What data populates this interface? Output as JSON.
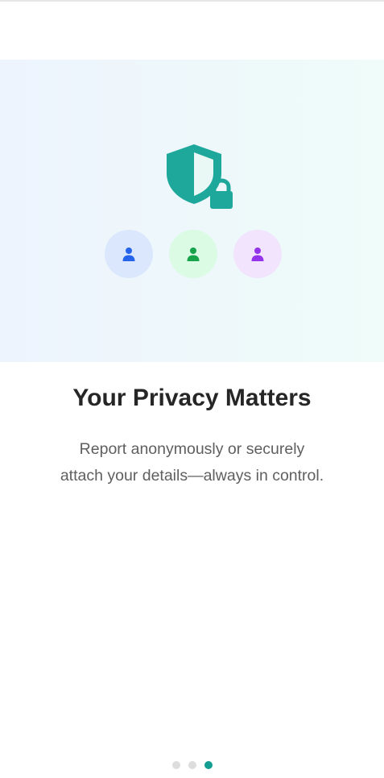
{
  "hero": {
    "main_icon": "shield-lock-icon",
    "avatars": [
      {
        "icon": "user-icon",
        "color": "#2563eb",
        "bg": "#dbe7fd"
      },
      {
        "icon": "user-icon",
        "color": "#16a34a",
        "bg": "#dbfbe5"
      },
      {
        "icon": "user-icon",
        "color": "#9333ea",
        "bg": "#f2e4fd"
      }
    ],
    "accent_color": "#1ea89c"
  },
  "onboarding": {
    "title": "Your Privacy Matters",
    "description": "Report anonymously or securely attach your details—always in control."
  },
  "pager": {
    "total": 3,
    "current": 3,
    "active_color": "#149e92",
    "inactive_color": "#dddddd"
  }
}
